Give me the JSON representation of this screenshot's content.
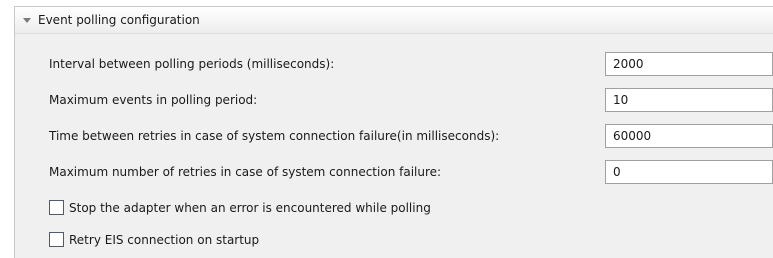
{
  "section": {
    "title": "Event polling configuration"
  },
  "fields": [
    {
      "label": "Interval between polling periods (milliseconds):",
      "value": "2000"
    },
    {
      "label": "Maximum events in polling period:",
      "value": "10"
    },
    {
      "label": "Time between retries in case of system connection failure(in milliseconds):",
      "value": "60000"
    },
    {
      "label": "Maximum number of retries in case of system connection failure:",
      "value": "0"
    }
  ],
  "checkboxes": [
    {
      "label": "Stop the adapter when an error is encountered while polling",
      "checked": false
    },
    {
      "label": "Retry EIS connection on startup",
      "checked": false
    }
  ],
  "icons": {
    "expand": "chevron-down-icon"
  }
}
